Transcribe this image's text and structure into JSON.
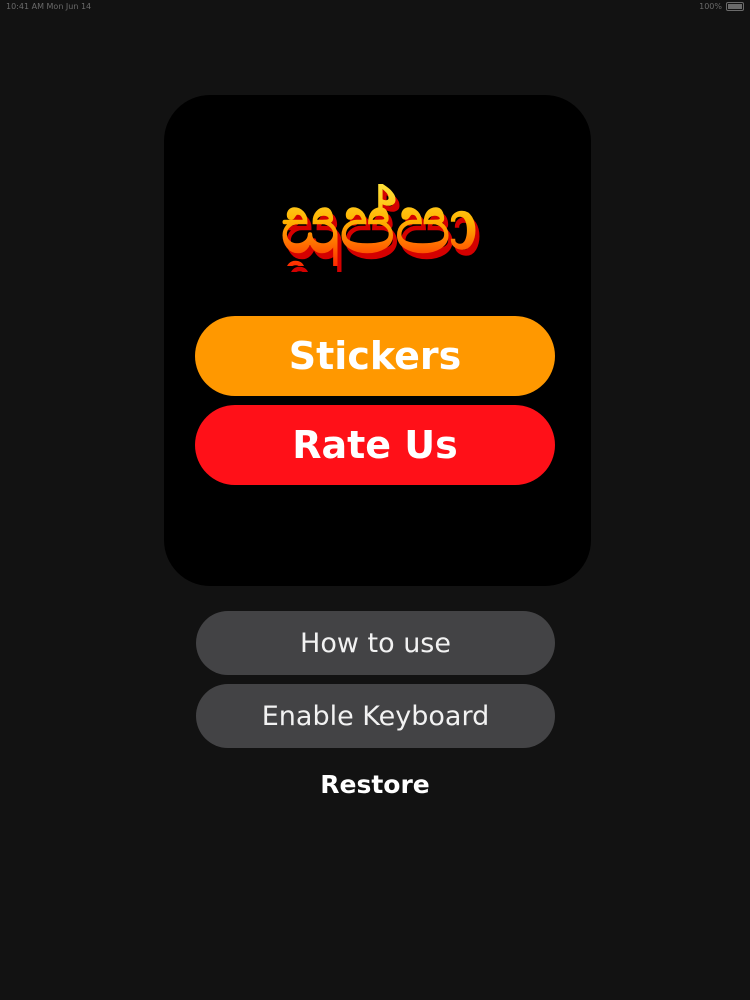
{
  "status_bar": {
    "left_text": "10:41 AM  Mon Jun 14",
    "right_text": "100%"
  },
  "logo": {
    "text": "සුප්පා"
  },
  "buttons": {
    "stickers": "Stickers",
    "rate_us": "Rate Us",
    "how_to_use": "How to use",
    "enable_keyboard": "Enable Keyboard",
    "restore": "Restore"
  },
  "colors": {
    "background": "#121212",
    "card": "#000000",
    "stickers": "#ff9800",
    "rate_us": "#ff1018",
    "secondary_button": "#434345"
  }
}
